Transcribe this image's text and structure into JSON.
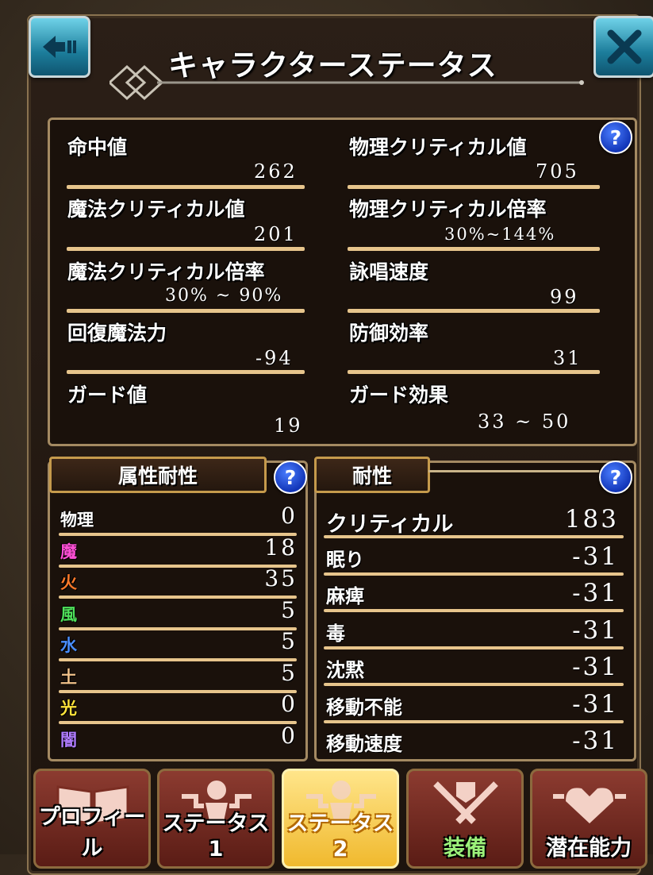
{
  "window": {
    "title": "キャラクターステータス",
    "back_icon": "back-arrow-icon",
    "close_icon": "close-x-icon"
  },
  "stats": [
    {
      "label": "命中値",
      "value": "262"
    },
    {
      "label": "物理クリティカル値",
      "value": "705"
    },
    {
      "label": "魔法クリティカル値",
      "value": "201"
    },
    {
      "label": "物理クリティカル倍率",
      "value": "30%~144%"
    },
    {
      "label": "魔法クリティカル倍率",
      "value": "30% ~ 90%"
    },
    {
      "label": "詠唱速度",
      "value": "99"
    },
    {
      "label": "回復魔法力",
      "value": "-94"
    },
    {
      "label": "防御効率",
      "value": "31"
    },
    {
      "label": "ガード値",
      "value": "19"
    },
    {
      "label": "ガード効果",
      "value": "33 ~ 50"
    }
  ],
  "help_mark": "?",
  "element_resist": {
    "header": "属性耐性",
    "rows": [
      {
        "label": "物理",
        "value": "0",
        "color": "#ffffff"
      },
      {
        "label": "魔",
        "value": "18",
        "color": "#ff4fd6"
      },
      {
        "label": "火",
        "value": "35",
        "color": "#ff7a2a"
      },
      {
        "label": "風",
        "value": "5",
        "color": "#4fe05a"
      },
      {
        "label": "水",
        "value": "5",
        "color": "#4a8fff"
      },
      {
        "label": "土",
        "value": "5",
        "color": "#f2c28a"
      },
      {
        "label": "光",
        "value": "0",
        "color": "#ffe23a"
      },
      {
        "label": "闇",
        "value": "0",
        "color": "#b07cff"
      }
    ]
  },
  "resist": {
    "header": "耐性",
    "rows": [
      {
        "label": "クリティカル",
        "value": "183"
      },
      {
        "label": "眠り",
        "value": "-31"
      },
      {
        "label": "麻痺",
        "value": "-31"
      },
      {
        "label": "毒",
        "value": "-31"
      },
      {
        "label": "沈黙",
        "value": "-31"
      },
      {
        "label": "移動不能",
        "value": "-31"
      },
      {
        "label": "移動速度",
        "value": "-31"
      }
    ]
  },
  "tabs": [
    {
      "label": "プロフィール",
      "icon": "book-icon",
      "active": false
    },
    {
      "label": "ステータス1",
      "icon": "status-emblem-icon",
      "active": false
    },
    {
      "label": "ステータス2",
      "icon": "status-emblem-icon",
      "active": true
    },
    {
      "label": "装備",
      "icon": "crossed-swords-icon",
      "active": false
    },
    {
      "label": "潜在能力",
      "icon": "heart-emblem-icon",
      "active": false
    }
  ]
}
